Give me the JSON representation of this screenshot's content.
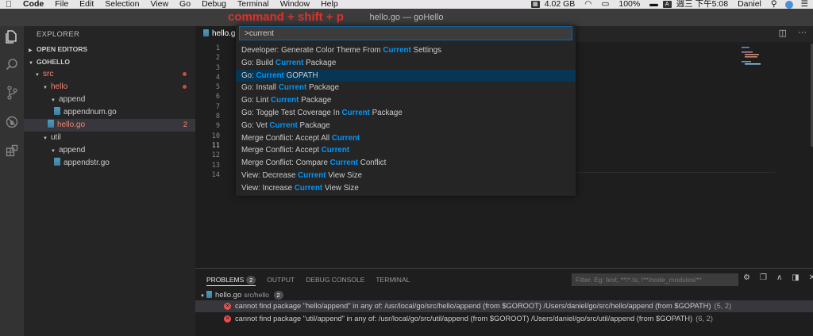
{
  "menubar": {
    "app": "Code",
    "items": [
      "File",
      "Edit",
      "Selection",
      "View",
      "Go",
      "Debug",
      "Terminal",
      "Window",
      "Help"
    ],
    "memory": "4.02 GB",
    "battery": "100%",
    "input_method": "A",
    "datetime": "週三 下午5:08",
    "user": "Daniel"
  },
  "window": {
    "title": "hello.go — goHello",
    "annotation": "command + shift + p"
  },
  "sidebar": {
    "title": "EXPLORER",
    "open_editors": "OPEN EDITORS",
    "project": "GOHELLO",
    "tree": [
      {
        "label": "src",
        "error": true
      },
      {
        "label": "hello",
        "error": true
      },
      {
        "label": "append"
      },
      {
        "label": "appendnum.go"
      },
      {
        "label": "hello.go",
        "error": true,
        "count": "2"
      },
      {
        "label": "util"
      },
      {
        "label": "append"
      },
      {
        "label": "appendstr.go"
      }
    ]
  },
  "editor": {
    "tab_label": "hello.go",
    "line_numbers": [
      "1",
      "2",
      "3",
      "4",
      "5",
      "6",
      "7",
      "8",
      "9",
      "10",
      "11",
      "12",
      "13",
      "14"
    ],
    "current_line": "11"
  },
  "palette": {
    "input_value": ">current",
    "commands": [
      {
        "pre": "Developer: Generate Color Theme From ",
        "hl": "Current",
        "post": " Settings"
      },
      {
        "pre": "Go: Build ",
        "hl": "Current",
        "post": " Package"
      },
      {
        "pre": "Go: ",
        "hl": "Current",
        "post": " GOPATH"
      },
      {
        "pre": "Go: Install ",
        "hl": "Current",
        "post": " Package"
      },
      {
        "pre": "Go: Lint ",
        "hl": "Current",
        "post": " Package"
      },
      {
        "pre": "Go: Toggle Test Coverage In ",
        "hl": "Current",
        "post": " Package"
      },
      {
        "pre": "Go: Vet ",
        "hl": "Current",
        "post": " Package"
      },
      {
        "pre": "Merge Conflict: Accept All ",
        "hl": "Current",
        "post": ""
      },
      {
        "pre": "Merge Conflict: Accept ",
        "hl": "Current",
        "post": ""
      },
      {
        "pre": "Merge Conflict: Compare ",
        "hl": "Current",
        "post": " Conflict"
      },
      {
        "pre": "View: Decrease ",
        "hl": "Current",
        "post": " View Size"
      },
      {
        "pre": "View: Increase ",
        "hl": "Current",
        "post": " View Size"
      }
    ]
  },
  "panel": {
    "tabs": {
      "problems": "PROBLEMS",
      "problems_count": "2",
      "output": "OUTPUT",
      "debug_console": "DEBUG CONSOLE",
      "terminal": "TERMINAL"
    },
    "filter_placeholder": "Filter. Eg: text, **/*.ts, !**/node_modules/**",
    "file": {
      "name": "hello.go",
      "path": "src/hello",
      "count": "2"
    },
    "problems": [
      {
        "message": "cannot find package \"hello/append\" in any of: /usr/local/go/src/hello/append (from $GOROOT) /Users/daniel/go/src/hello/append (from $GOPATH)",
        "location": "(5, 2)"
      },
      {
        "message": "cannot find package \"util/append\" in any of: /usr/local/go/src/util/append (from $GOROOT) /Users/daniel/go/src/util/append (from $GOPATH)",
        "location": "(6, 2)"
      }
    ]
  },
  "colors": {
    "accent": "#0097fb",
    "error": "#f48771",
    "annotation": "#e0312a"
  }
}
